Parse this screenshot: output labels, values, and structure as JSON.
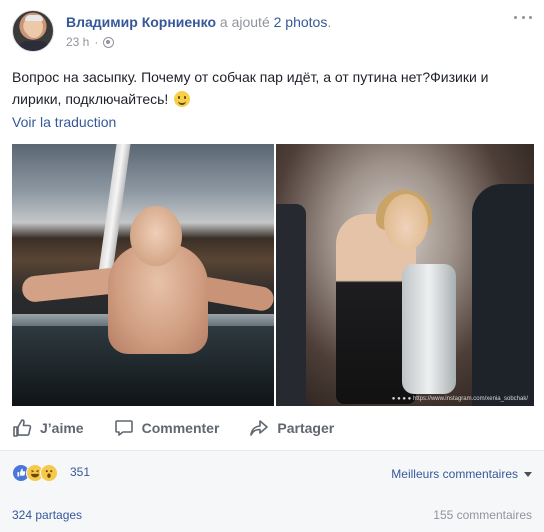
{
  "post": {
    "author_name": "Владимир Корниенко",
    "action_prefix": " a ajouté ",
    "action_photos": "2 photos",
    "action_suffix": ".",
    "timestamp": "23 h",
    "dot": "·",
    "text": "Вопрос на засыпку. Почему от собчак пар идёт, а от путина нет?Физики и лирики, подключайтесь!",
    "translate_link": "Voir la traduction",
    "photo_credit": "● ● ● ● https://www.instagram.com/xenia_sobchak/"
  },
  "actions": {
    "like": "J’aime",
    "comment": "Commenter",
    "share": "Partager"
  },
  "reactions": {
    "count": "351",
    "types": [
      "like-reaction",
      "haha-reaction",
      "wow-reaction"
    ],
    "sort_label": "Meilleurs commentaires",
    "shares": "324 partages",
    "comments": "155 commentaires"
  },
  "colors": {
    "link": "#365899",
    "meta": "#90949c",
    "footer_bg": "#f6f7f9"
  }
}
